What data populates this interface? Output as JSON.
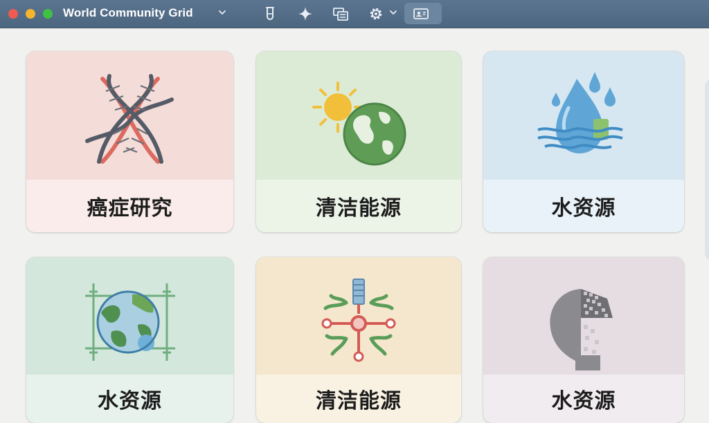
{
  "window": {
    "title": "World Community Grid"
  },
  "toolbar": {
    "icons": [
      "beaker-icon",
      "sparkle-icon",
      "tasks-icon",
      "gear-icon",
      "screensaver-icon"
    ]
  },
  "cards": [
    {
      "label": "癌症研究",
      "icon": "dna-icon",
      "color": "#f4dcd9"
    },
    {
      "label": "清洁能源",
      "icon": "sun-globe-icon",
      "color": "#dcebd6"
    },
    {
      "label": "水资源",
      "icon": "water-drop-icon",
      "color": "#d6e7f2"
    },
    {
      "label": "水资源",
      "icon": "globe-grid-icon",
      "color": "#d3e7dd"
    },
    {
      "label": "清洁能源",
      "icon": "molecule-icon",
      "color": "#f5e7cd"
    },
    {
      "label": "水资源",
      "icon": "pixel-head-icon",
      "color": "#e6dde2"
    }
  ]
}
